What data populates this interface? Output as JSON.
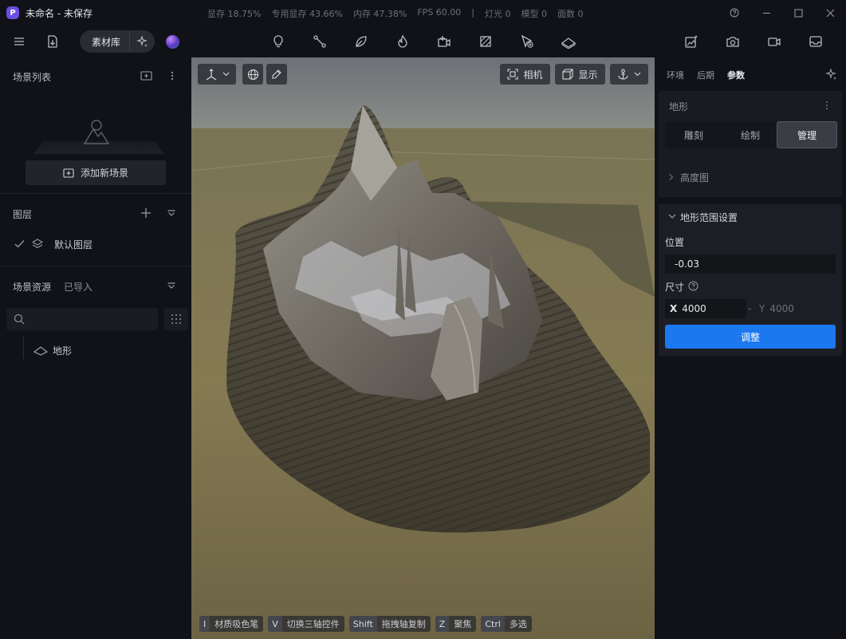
{
  "window": {
    "logo_letter": "P",
    "title": "未命名 - 未保存",
    "stats": [
      "显存 18.75%",
      "专用显存 43.66%",
      "内存 47.38%",
      "FPS 60.00",
      "|",
      "灯光 0",
      "模型 0",
      "面数 0"
    ]
  },
  "toolbar": {
    "asset_library_label": "素材库",
    "center_tools": [
      "light-bulb-icon",
      "path-icon",
      "leaf-icon",
      "flame-icon",
      "add-video-icon",
      "hatch-icon",
      "cursor-add-icon",
      "terrain-icon"
    ],
    "right_tools": [
      "magic-image-icon",
      "camera-icon",
      "video-icon",
      "tray-icon"
    ]
  },
  "left": {
    "scene_list_title": "场景列表",
    "add_scene_label": "添加新场景",
    "layers_title": "图层",
    "default_layer_label": "默认图层",
    "assets_title": "场景资源",
    "assets_subtitle": "已导入",
    "search_placeholder": "",
    "asset_items": [
      "地形"
    ]
  },
  "viewport": {
    "camera_label": "相机",
    "display_label": "显示",
    "hints": [
      {
        "key": "I",
        "label": "材质吸色笔"
      },
      {
        "key": "V",
        "label": "切换三轴控件"
      },
      {
        "key": "Shift",
        "label": "拖拽轴复制"
      },
      {
        "key": "Z",
        "label": "聚焦"
      },
      {
        "key": "Ctrl",
        "label": "多选"
      }
    ]
  },
  "right": {
    "tabs": [
      "环境",
      "后期",
      "参数"
    ],
    "active_tab": "参数",
    "terrain_title": "地形",
    "terrain_modes": [
      "雕刻",
      "绘制",
      "管理"
    ],
    "active_mode": "管理",
    "heightmap_label": "高度图",
    "range_title": "地形范围设置",
    "position_label": "位置",
    "position_value": "-0.03",
    "size_label": "尺寸",
    "size_x_label": "X",
    "size_x_value": "4000",
    "size_sep": "-",
    "size_y_label": "Y",
    "size_y_value": "4000",
    "apply_label": "调整"
  },
  "colors": {
    "accent": "#1c78ef",
    "background": "#111217",
    "panel": "#1d1e25"
  }
}
